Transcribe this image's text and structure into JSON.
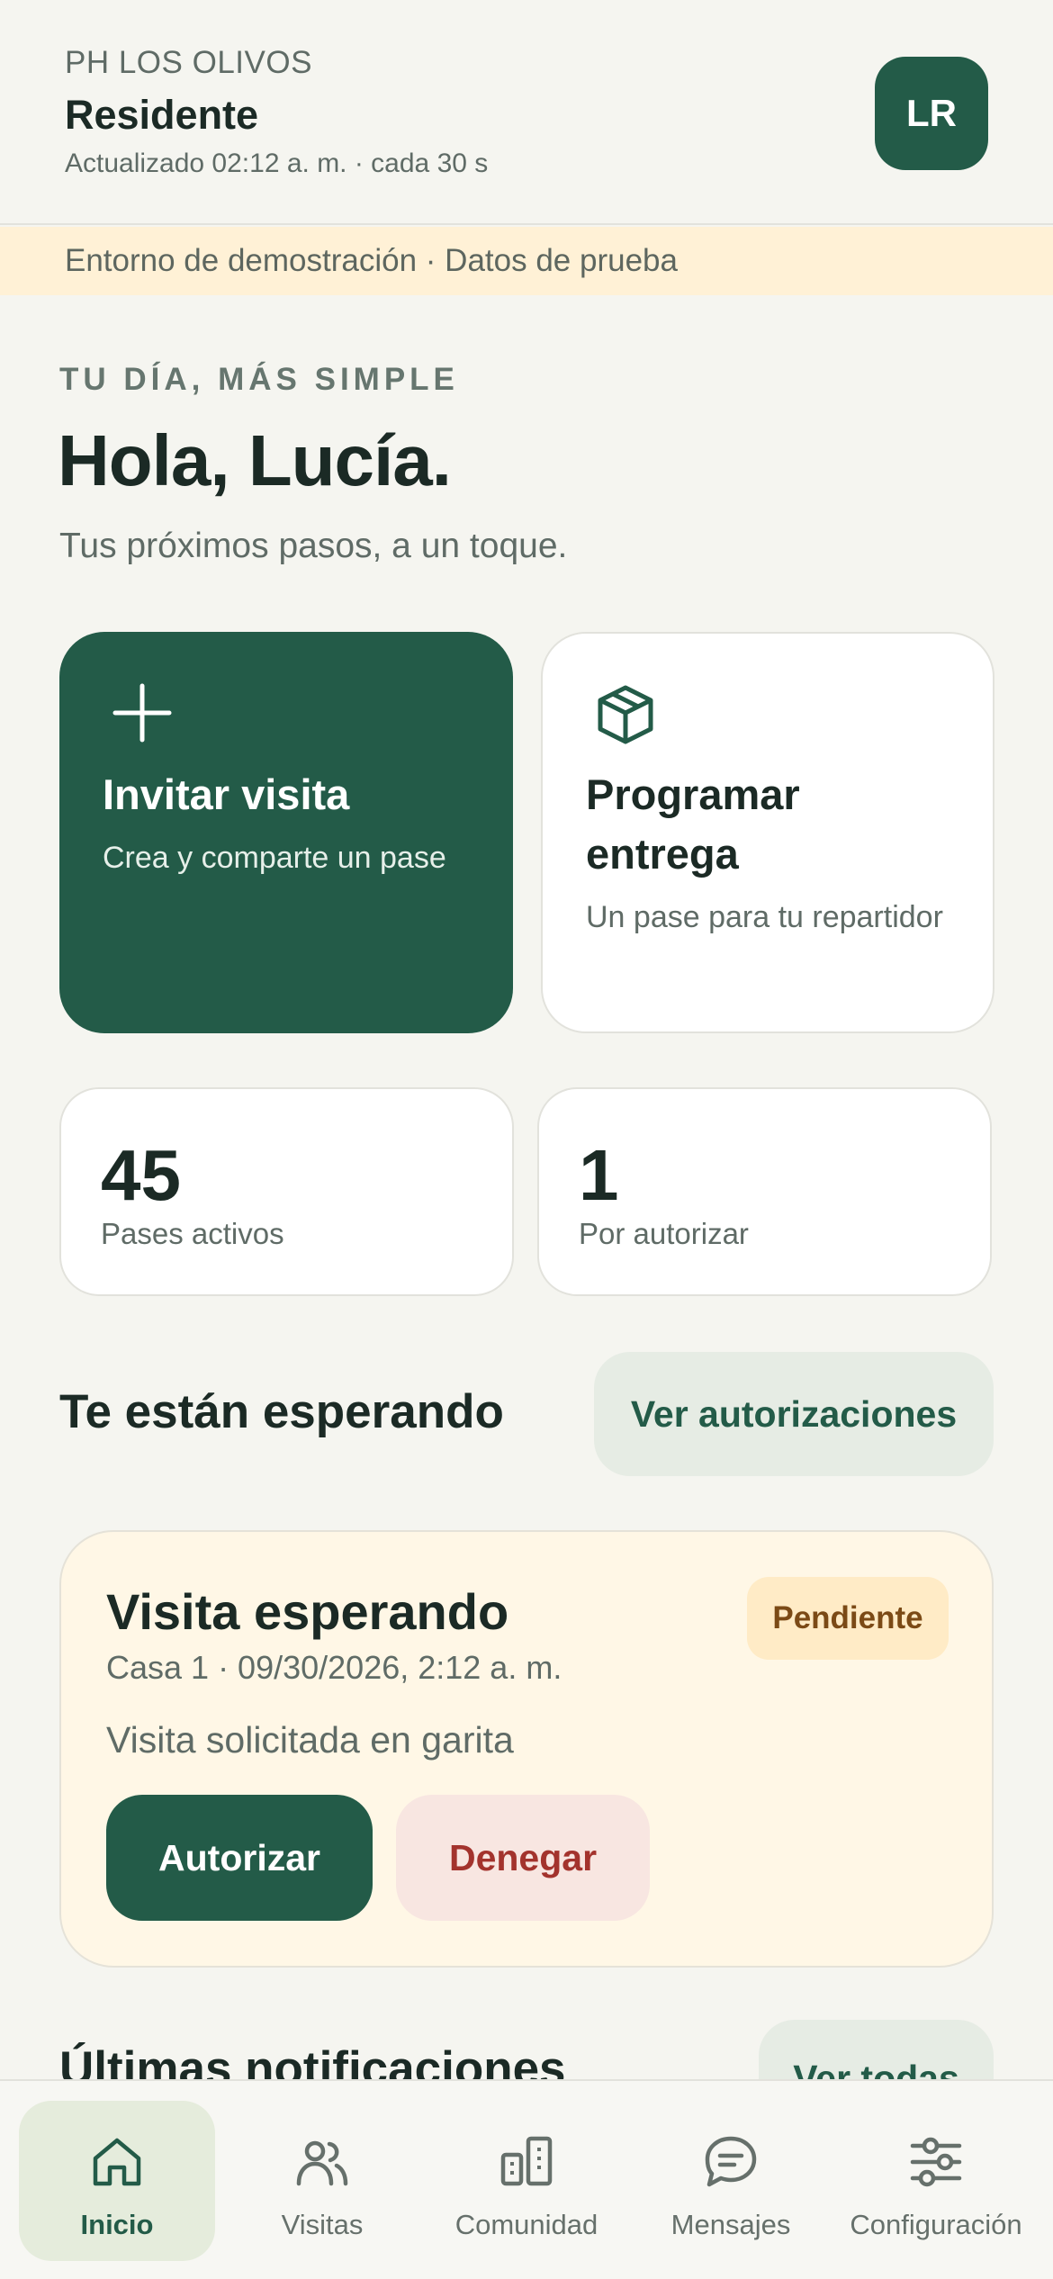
{
  "header": {
    "org": "PH LOS OLIVOS",
    "role": "Residente",
    "updated": "Actualizado 02:12 a. m. · cada 30 s",
    "avatar_initials": "LR"
  },
  "demo_banner": "Entorno de demostración · Datos de prueba",
  "greeting": {
    "eyebrow": "TU DÍA, MÁS SIMPLE",
    "hello": "Hola, Lucía.",
    "subtitle": "Tus próximos pasos, a un toque."
  },
  "actions": [
    {
      "title": "Invitar visita",
      "subtitle": "Crea y comparte un pase",
      "icon": "plus-icon"
    },
    {
      "title": "Programar entrega",
      "subtitle": "Un pase para tu repartidor",
      "icon": "package-icon"
    }
  ],
  "stats": [
    {
      "value": "45",
      "label": "Pases activos"
    },
    {
      "value": "1",
      "label": "Por autorizar"
    }
  ],
  "waiting_section": {
    "title": "Te están esperando",
    "button": "Ver autorizaciones"
  },
  "waiting_card": {
    "title": "Visita esperando",
    "meta": "Casa 1 · 09/30/2026, 2:12 a. m.",
    "badge": "Pendiente",
    "description": "Visita solicitada en garita",
    "authorize": "Autorizar",
    "deny": "Denegar"
  },
  "notifications_section": {
    "title": "Últimas notificaciones",
    "button": "Ver todas"
  },
  "nav": [
    {
      "label": "Inicio",
      "icon": "home-icon",
      "active": true
    },
    {
      "label": "Visitas",
      "icon": "users-icon"
    },
    {
      "label": "Comunidad",
      "icon": "building-icon"
    },
    {
      "label": "Mensajes",
      "icon": "message-icon"
    },
    {
      "label": "Configuración",
      "icon": "sliders-icon"
    }
  ],
  "colors": {
    "primary": "#235b48",
    "background": "#f5f5f0",
    "banner": "#fff1d6",
    "pending_card": "#fff7e6",
    "deny": "#a3332d"
  }
}
